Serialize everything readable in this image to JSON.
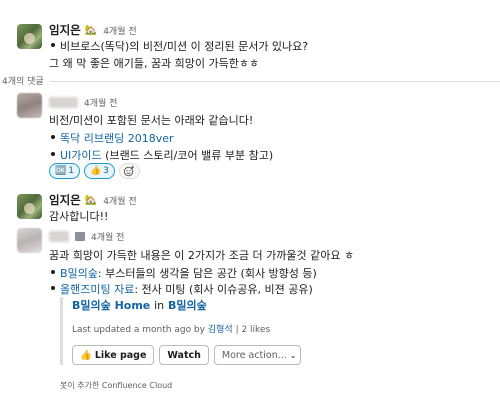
{
  "thread_parent": {
    "author": "임지은",
    "status_emoji": "🏡",
    "time": "4개월 전",
    "bullet": "비브로스(똑닥)의 비전/미션 이 정리된 문서가 있나요?",
    "line2": "그 왜 막 좋은 애기들, 꿈과 희망이 가득한ㅎㅎ"
  },
  "thread_meta": {
    "reply_count": "4개의 댓글"
  },
  "reply1": {
    "time": "4개월 전",
    "intro": "비전/미션이 포함된 문서는 아래와 같습니다!",
    "bullets": [
      {
        "link": "똑닥 리브랜딩 2018ver",
        "rest": ""
      },
      {
        "link": "UI가이드",
        "rest": " (브랜드 스토리/코어 밸류 부분 참고)"
      }
    ],
    "reactions": [
      {
        "emoji": "🆗",
        "count": "1"
      },
      {
        "emoji": "👍",
        "count": "3"
      }
    ]
  },
  "reply2": {
    "author": "임지은",
    "status_emoji": "🏡",
    "time": "4개월 전",
    "text": "감사합니다!!"
  },
  "reply3": {
    "time": "4개월 전",
    "intro": "꿈과 희망이 가득한 내용은 이 2가지가 조금 더 가까울것 같아요 ㅎ",
    "bullets": [
      {
        "link": "B밀의숲",
        "rest": ": 부스터들의 생각을 담은 공간 (회사 방향성 등)"
      },
      {
        "link": "올핸즈미팅 자료",
        "rest": ": 전사 미팅 (회사 이슈공유, 비젼 공유)"
      }
    ],
    "unfurl": {
      "title_link": "B밀의숲 Home",
      "title_in": "in",
      "title_space": "B밀의숲",
      "updated_prefix": "Last updated a month ago by",
      "updated_user": "김형석",
      "likes": "| 2 likes",
      "like_button": "Like page",
      "watch_button": "Watch",
      "more_action": "More action...",
      "footer": "봇이 추가한 Confluence Cloud"
    }
  },
  "colors": {
    "link": "#1264a3",
    "reaction_border": "#1d9bd1",
    "reaction_bg": "#e8f5fa"
  }
}
